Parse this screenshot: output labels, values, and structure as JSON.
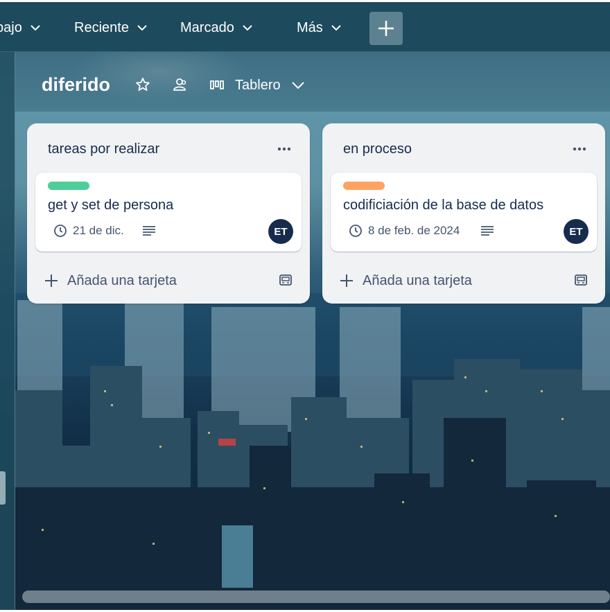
{
  "topnav": {
    "items": [
      {
        "label": "bajo"
      },
      {
        "label": "Reciente"
      },
      {
        "label": "Marcado"
      },
      {
        "label": "Más"
      }
    ],
    "create_icon": "plus-icon"
  },
  "board": {
    "title": "diferido",
    "view_label": "Tablero",
    "star_icon": "star-icon",
    "visibility_icon": "team-visibility-icon",
    "view_icon": "board-view-icon"
  },
  "lists": [
    {
      "title": "tareas por realizar",
      "cards": [
        {
          "label_color": "#4bce97",
          "title": "get y set de persona",
          "due": "21 de dic.",
          "member_initials": "ET"
        }
      ],
      "add_card_label": "Añada una tarjeta"
    },
    {
      "title": "en proceso",
      "cards": [
        {
          "label_color": "#fea362",
          "title": "codificiación de la base de datos",
          "due": "8 de feb. de 2024",
          "member_initials": "ET"
        }
      ],
      "add_card_label": "Añada una tarjeta"
    }
  ],
  "colors": {
    "topbar": "#1d4a5c",
    "list_bg": "#f1f2f4",
    "avatar_bg": "#172b4d"
  }
}
